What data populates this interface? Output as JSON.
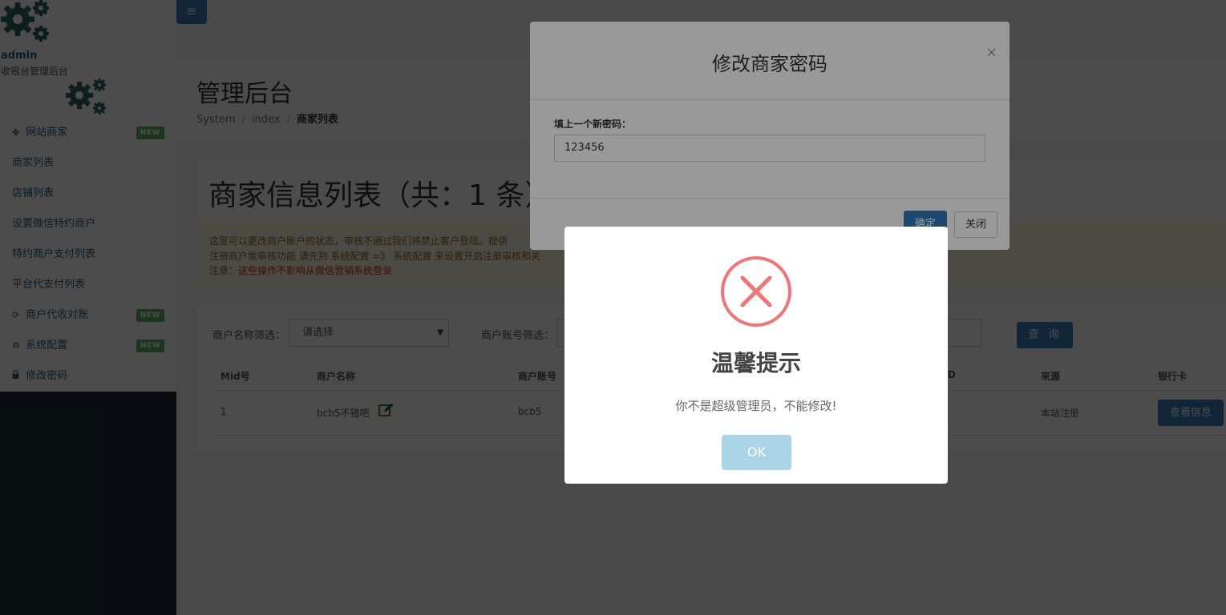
{
  "sidebar": {
    "user_name": "admin",
    "user_subtitle": "收银台管理后台",
    "items": [
      {
        "label": "网站商家",
        "icon": "puzzle-icon",
        "badge": "NEW"
      },
      {
        "label": "商家列表"
      },
      {
        "label": "店铺列表"
      },
      {
        "label": "设置微信特约商户"
      },
      {
        "label": "特约商户支付列表"
      },
      {
        "label": "平台代支付列表"
      },
      {
        "label": "商户代收对账",
        "icon": "refresh-icon",
        "badge": "NEW"
      },
      {
        "label": "系统配置",
        "icon": "gear-icon",
        "badge": "NEW"
      },
      {
        "label": "修改密码",
        "icon": "lock-icon"
      }
    ]
  },
  "header": {
    "menu_toggle": "≡",
    "page_title": "管理后台",
    "breadcrumb": [
      "System",
      "index",
      "商家列表"
    ],
    "breadcrumb_sep": "/"
  },
  "main": {
    "list_title": "商家信息列表（共：1 条）",
    "notice": {
      "line1": "这里可以更改商户账户的状态，审核不通过我们将禁止客户登陆。提供",
      "line2": "注册商户需审核功能 请先到 系统配置 =》 系统配置 来设置开启注册审核和关",
      "line3_prefix": "注意：",
      "line3_red": "这些操作不影响从微信营销系统登录"
    },
    "filters": {
      "name_label": "商户名称筛选：",
      "name_select": "请选择",
      "account_label": "商户账号筛选：",
      "query_button": "查 询"
    },
    "table": {
      "headers": [
        "Mid号",
        "商户名称",
        "商户账号",
        "D",
        "来源",
        "银行卡"
      ],
      "rows": [
        {
          "mid": "1",
          "name": "bcb5不错吧",
          "account": "bcb5",
          "source": "本站注册",
          "action": "查看信息"
        }
      ]
    }
  },
  "password_modal": {
    "title": "修改商家密码",
    "close": "×",
    "field_label": "填上一个新密码：",
    "field_value": "123456",
    "confirm_button": "确定",
    "cancel_button": "关闭"
  },
  "alert": {
    "title": "温馨提示",
    "message": "你不是超级管理员，不能修改!",
    "ok_button": "OK",
    "icon": "error-x-icon",
    "icon_color": "#f27474"
  },
  "colors": {
    "primary": "#337ab7",
    "badge_green": "#5cb85c",
    "sidebar_dark": "#1c2b36",
    "gear_green": "#2a6b5b"
  }
}
